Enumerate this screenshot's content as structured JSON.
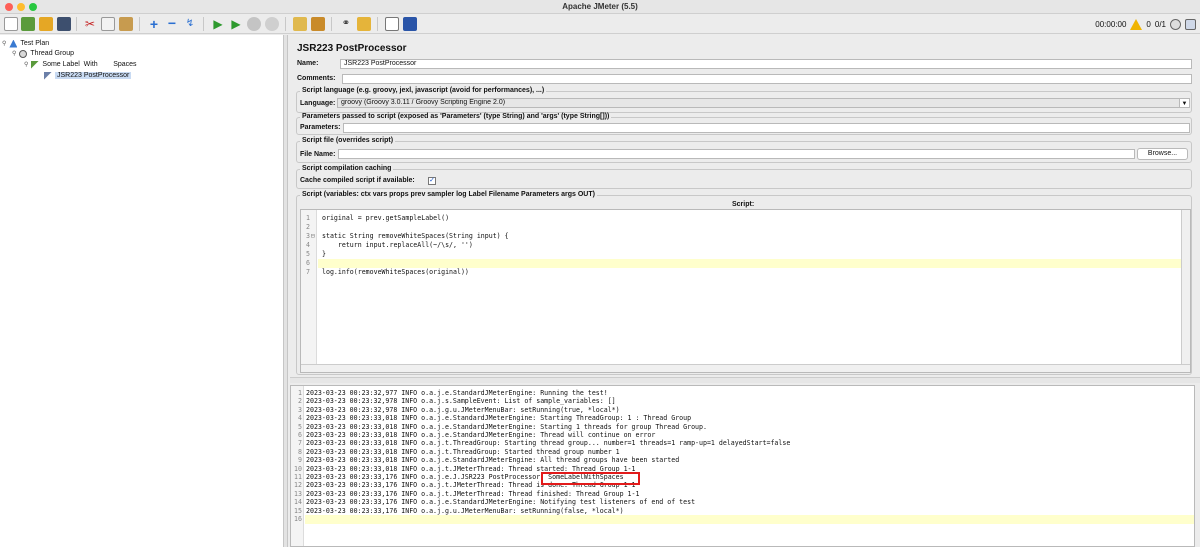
{
  "window": {
    "title": "Apache JMeter (5.5)"
  },
  "toolbar": {
    "icons": [
      "new-icon",
      "templates-icon",
      "open-icon",
      "save-icon",
      "cut-icon",
      "copy-icon",
      "paste-icon",
      "expand-icon",
      "collapse-icon",
      "toggle-icon",
      "start-icon",
      "start-no-pauses-icon",
      "stop-icon",
      "shutdown-icon",
      "clear-icon",
      "clear-all-icon",
      "search-icon",
      "reset-search-icon",
      "function-helper-icon",
      "help-icon"
    ],
    "timer": "00:00:00",
    "warnings": "0",
    "threads": "0/1"
  },
  "tree": {
    "nodes": [
      {
        "label": "Test Plan"
      },
      {
        "label": "Thread Group"
      },
      {
        "label": "Some Label  With        Spaces"
      },
      {
        "label": "JSR223 PostProcessor"
      }
    ]
  },
  "panel": {
    "title": "JSR223 PostProcessor",
    "name_label": "Name:",
    "name_value": "JSR223 PostProcessor",
    "comments_label": "Comments:",
    "comments_value": "",
    "script_language": {
      "group_title": "Script language (e.g. groovy, jexl, javascript (avoid for performances), ...)",
      "label": "Language:",
      "value": "groovy      (Groovy 3.0.11 / Groovy Scripting Engine 2.0)"
    },
    "parameters": {
      "group_title": "Parameters passed to script (exposed as 'Parameters' (type String) and 'args' (type String[]))",
      "label": "Parameters:",
      "value": ""
    },
    "script_file": {
      "group_title": "Script file (overrides script)",
      "label": "File Name:",
      "value": "",
      "browse": "Browse..."
    },
    "caching": {
      "group_title": "Script compilation caching",
      "label": "Cache compiled script if available:",
      "checked": true
    },
    "script": {
      "group_title": "Script (variables: ctx vars props prev sampler log Label Filename Parameters args OUT)",
      "header": "Script:",
      "line_numbers": [
        "1",
        "2",
        "3",
        "4",
        "5",
        "6",
        "7"
      ],
      "lines": [
        "original = prev.getSampleLabel()",
        "",
        "static String removeWhiteSpaces(String input) {",
        "    return input.replaceAll(~/\\s/, '')",
        "}",
        "",
        "log.info(removeWhiteSpaces(original))"
      ],
      "fold_markers": [
        "",
        "",
        "⊟",
        "",
        "",
        "",
        ""
      ],
      "highlight_line": 6
    }
  },
  "log": {
    "line_numbers": [
      "1",
      "2",
      "3",
      "4",
      "5",
      "6",
      "7",
      "8",
      "9",
      "10",
      "11",
      "12",
      "13",
      "14",
      "15",
      "16"
    ],
    "lines": [
      "2023-03-23 00:23:32,977 INFO o.a.j.e.StandardJMeterEngine: Running the test!",
      "2023-03-23 00:23:32,978 INFO o.a.j.s.SampleEvent: List of sample_variables: []",
      "2023-03-23 00:23:32,978 INFO o.a.j.g.u.JMeterMenuBar: setRunning(true, *local*)",
      "2023-03-23 00:23:33,018 INFO o.a.j.e.StandardJMeterEngine: Starting ThreadGroup: 1 : Thread Group",
      "2023-03-23 00:23:33,018 INFO o.a.j.e.StandardJMeterEngine: Starting 1 threads for group Thread Group.",
      "2023-03-23 00:23:33,018 INFO o.a.j.e.StandardJMeterEngine: Thread will continue on error",
      "2023-03-23 00:23:33,018 INFO o.a.j.t.ThreadGroup: Starting thread group... number=1 threads=1 ramp-up=1 delayedStart=false",
      "2023-03-23 00:23:33,018 INFO o.a.j.t.ThreadGroup: Started thread group number 1",
      "2023-03-23 00:23:33,018 INFO o.a.j.e.StandardJMeterEngine: All thread groups have been started",
      "2023-03-23 00:23:33,018 INFO o.a.j.t.JMeterThread: Thread started: Thread Group 1-1",
      "2023-03-23 00:23:33,176 INFO o.a.j.e.J.JSR223 PostProcessor: SomeLabelWithSpaces",
      "2023-03-23 00:23:33,176 INFO o.a.j.t.JMeterThread: Thread is done: Thread Group 1-1",
      "2023-03-23 00:23:33,176 INFO o.a.j.t.JMeterThread: Thread finished: Thread Group 1-1",
      "2023-03-23 00:23:33,176 INFO o.a.j.e.StandardJMeterEngine: Notifying test listeners of end of test",
      "2023-03-23 00:23:33,176 INFO o.a.j.g.u.JMeterMenuBar: setRunning(false, *local*)",
      ""
    ],
    "highlight_line": 16,
    "boxed_text": ": SomeLabelWithSpaces"
  },
  "colors": {
    "accent_box": "#e21a1a",
    "selection": "#c9dbf3",
    "current_line": "#ffffcc"
  }
}
